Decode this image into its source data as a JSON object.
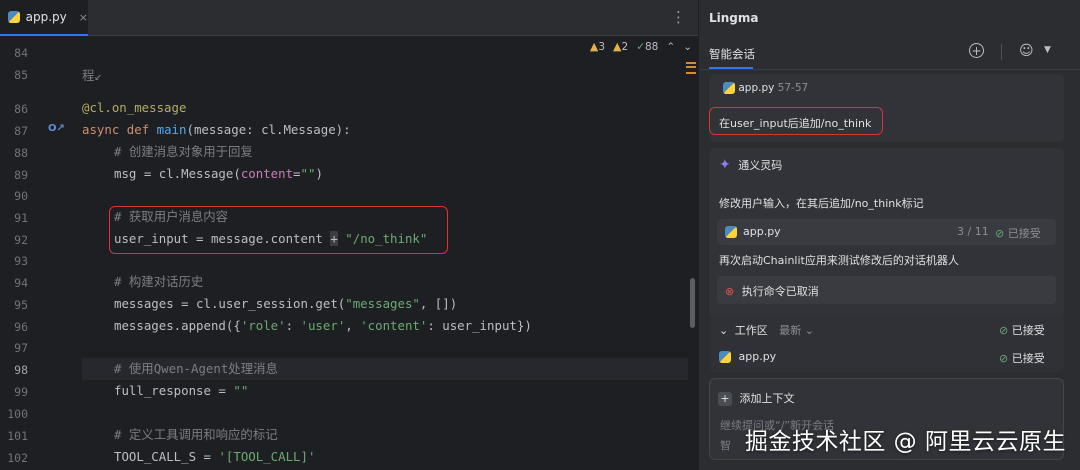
{
  "editor": {
    "tab_label": "app.py",
    "tab_close": "×",
    "menu_glyph": "⋮",
    "inspections": {
      "warnings": "3",
      "weak_warnings": "2",
      "typos": "88"
    },
    "gutter_marker": "O↗",
    "lines": [
      {
        "n": "84"
      },
      {
        "n": "85"
      },
      {
        "n": "86"
      },
      {
        "n": "87"
      },
      {
        "n": "88"
      },
      {
        "n": "89"
      },
      {
        "n": "90"
      },
      {
        "n": "91"
      },
      {
        "n": "92"
      },
      {
        "n": "93"
      },
      {
        "n": "94"
      },
      {
        "n": "95"
      },
      {
        "n": "96"
      },
      {
        "n": "97"
      },
      {
        "n": "98"
      },
      {
        "n": "99"
      },
      {
        "n": "100"
      },
      {
        "n": "101"
      },
      {
        "n": "102"
      }
    ],
    "code": {
      "l85_fragment": "程↙",
      "l86_decorator": "@cl.on_message",
      "l87_async": "async",
      "l87_def": "def",
      "l87_main": "main",
      "l87_rest": "(message: cl.Message):",
      "l88_comment": "# 创建消息对象用于回复",
      "l89_a": "msg = cl.Message(",
      "l89_param": "content",
      "l89_eq": "=",
      "l89_str": "\"\"",
      "l89_close": ")",
      "l91_comment": "# 获取用户消息内容",
      "l92_a": "user_input = message.content ",
      "l92_plus": "+",
      "l92_str": "\"/no_think\"",
      "l94_comment": "# 构建对话历史",
      "l95_a": "messages = cl.user_session.get(",
      "l95_str": "\"messages\"",
      "l95_b": ", [])",
      "l96_a": "messages.append({",
      "l96_s1": "'role'",
      "l96_b": ": ",
      "l96_s2": "'user'",
      "l96_c": ", ",
      "l96_s3": "'content'",
      "l96_d": ": user_input})",
      "l98_comment": "# 使用Qwen-Agent处理消息",
      "l99_a": "full_response = ",
      "l99_str": "\"\"",
      "l101_comment": "# 定义工具调用和响应的标记",
      "l102_a": "TOOL_CALL_S = ",
      "l102_str": "'[TOOL_CALL]'"
    }
  },
  "panel": {
    "title": "Lingma",
    "chat_tab": "智能会话",
    "add_glyph": "+",
    "user_glyph": "☺",
    "caret": "▼",
    "context_file": "app.py",
    "context_range": "57-57",
    "user_message": "在user_input后追加/no_think",
    "assistant_name": "通义灵码",
    "assistant_icon": "✦",
    "reply_1": "修改用户输入，在其后追加/no_think标记",
    "change_file": "app.py",
    "change_count": "3 / 11",
    "accepted": "已接受",
    "reply_2": "再次启动Chainlit应用来测试修改后的对话机器人",
    "cancelled": "执行命令已取消",
    "workspace": "工作区",
    "latest": "最新",
    "workspace_file": "app.py",
    "add_context": "添加上下文",
    "input_placeholder_1": "继续提问或“/”新开会话",
    "input_placeholder_2": "智"
  },
  "watermark": "掘金技术社区 @ 阿里云云原生",
  "colors": {
    "accent": "#3574f0",
    "highlight_box": "#e0312f",
    "accepted_green": "#6ba57a",
    "warning": "#e0b44c"
  }
}
